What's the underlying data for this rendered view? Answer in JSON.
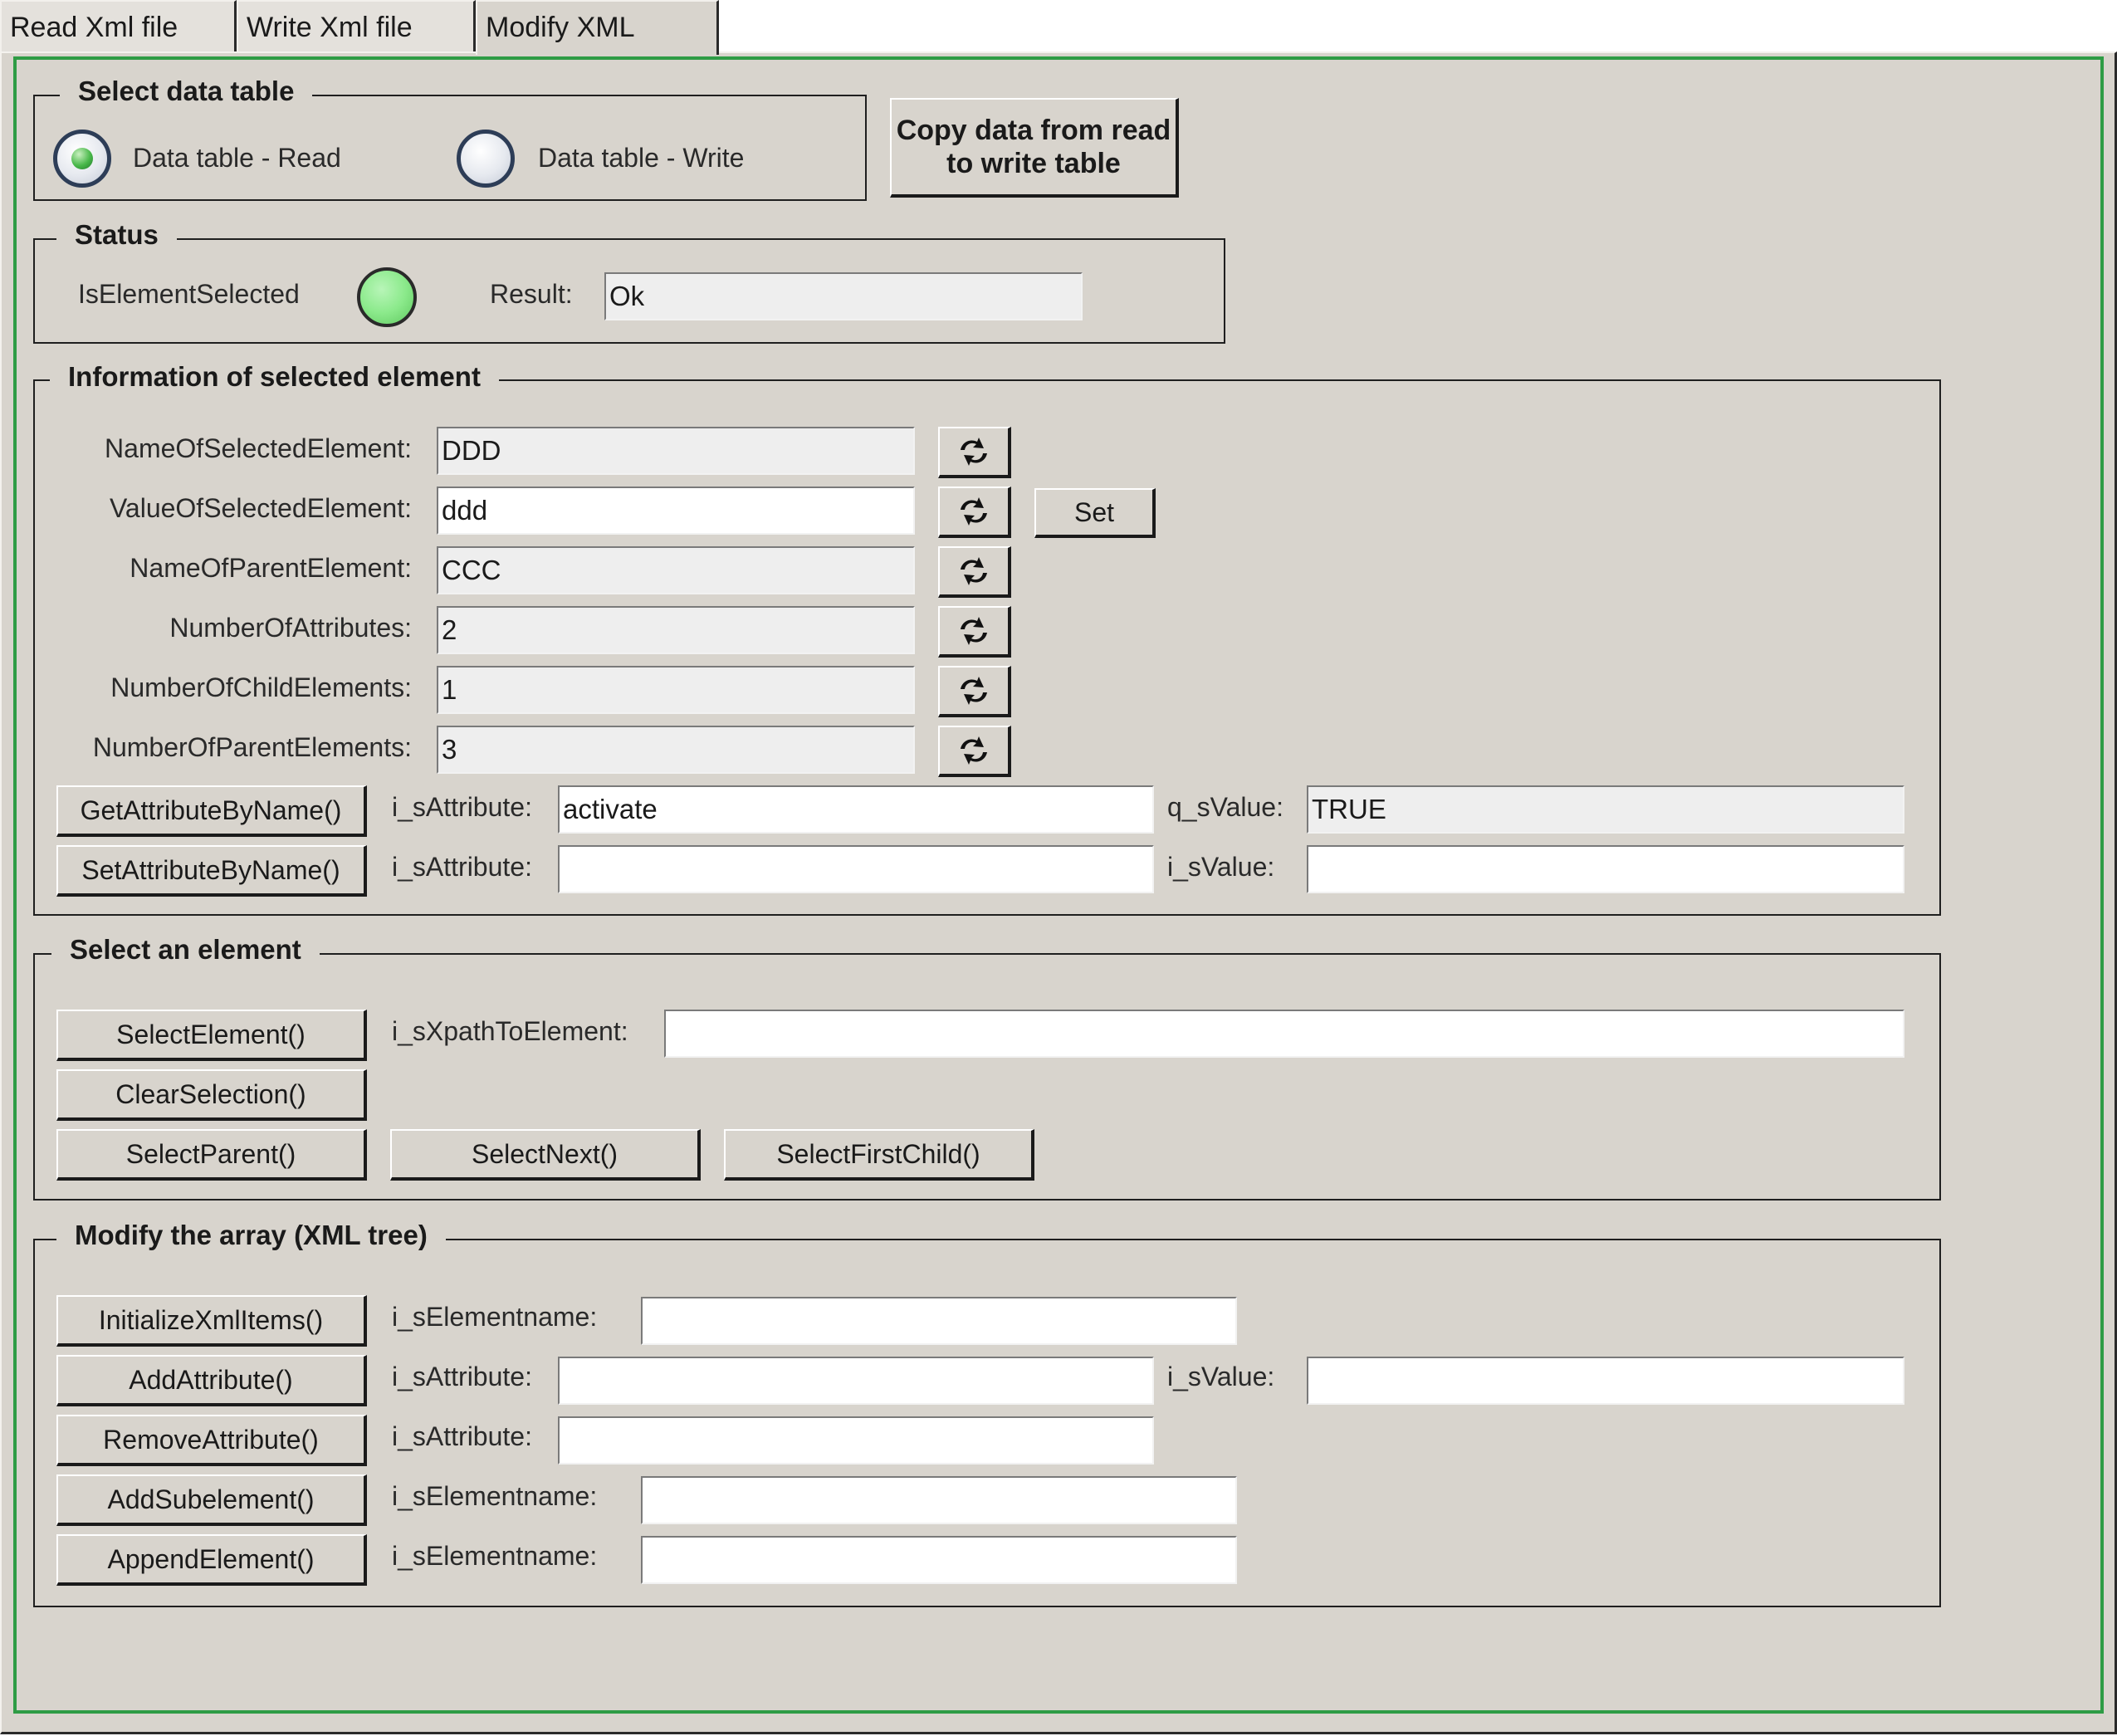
{
  "tabs": [
    {
      "label": "Read Xml file"
    },
    {
      "label": "Write Xml file"
    },
    {
      "label": "Modify XML"
    }
  ],
  "select_data_table": {
    "title": "Select data table",
    "radio_read_label": "Data table - Read",
    "radio_write_label": "Data table - Write",
    "selected": "read",
    "copy_button": "Copy data from read to write table"
  },
  "status": {
    "title": "Status",
    "is_element_selected_label": "IsElementSelected",
    "led_color": "#8cea8c",
    "result_label": "Result:",
    "result_value": "Ok"
  },
  "info": {
    "title": "Information of selected element",
    "rows": [
      {
        "label": "NameOfSelectedElement:",
        "value": "DDD"
      },
      {
        "label": "ValueOfSelectedElement:",
        "value": "ddd"
      },
      {
        "label": "NameOfParentElement:",
        "value": "CCC"
      },
      {
        "label": "NumberOfAttributes:",
        "value": "2"
      },
      {
        "label": "NumberOfChildElements:",
        "value": "1"
      },
      {
        "label": "NumberOfParentElements:",
        "value": "3"
      }
    ],
    "set_button": "Set",
    "refresh_icon": "refresh-icon",
    "get_attr_button": "GetAttributeByName()",
    "get_attr_label": "i_sAttribute:",
    "get_attr_value": "activate",
    "get_value_label": "q_sValue:",
    "get_value_value": "TRUE",
    "set_attr_button": "SetAttributeByName()",
    "set_attr_label": "i_sAttribute:",
    "set_attr_value": "",
    "set_value_label": "i_sValue:",
    "set_value_value": ""
  },
  "select_element": {
    "title": "Select an element",
    "select_button": "SelectElement()",
    "xpath_label": "i_sXpathToElement:",
    "xpath_value": "",
    "clear_button": "ClearSelection()",
    "parent_button": "SelectParent()",
    "next_button": "SelectNext()",
    "first_child_button": "SelectFirstChild()"
  },
  "modify": {
    "title": "Modify the array (XML tree)",
    "init_button": "InitializeXmlItems()",
    "init_label": "i_sElementname:",
    "add_attr_button": "AddAttribute()",
    "add_attr_label": "i_sAttribute:",
    "add_attr_value_label": "i_sValue:",
    "remove_attr_button": "RemoveAttribute()",
    "remove_attr_label": "i_sAttribute:",
    "add_sub_button": "AddSubelement()",
    "add_sub_label": "i_sElementname:",
    "append_button": "AppendElement()",
    "append_label": "i_sElementname:"
  }
}
